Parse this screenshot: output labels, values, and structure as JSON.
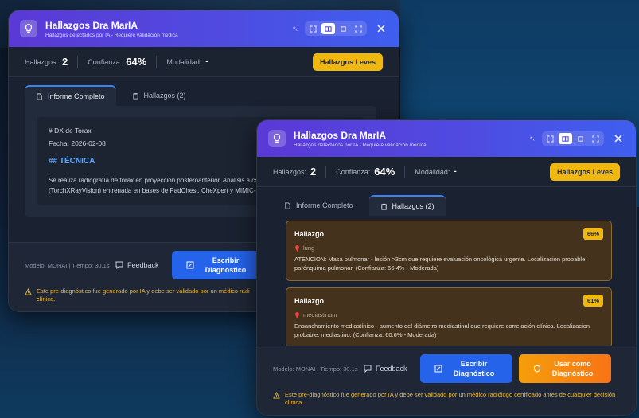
{
  "colors": {
    "accent": "#4f4be0",
    "warning": "#f0b70f",
    "primary": "#2563eb",
    "orange": "#f97316"
  },
  "window1": {
    "title": "Hallazgos Dra MarIA",
    "subtitle": "Hallazgos detectados por IA - Requiere validación médica",
    "stats": {
      "findings_label": "Hallazgos:",
      "findings_value": "2",
      "confidence_label": "Confianza:",
      "confidence_value": "64%",
      "modality_label": "Modalidad:",
      "modality_value": "-"
    },
    "severity_badge": "Hallazgos Leves",
    "tabs": [
      {
        "label": "Informe Completo",
        "icon": "document-icon"
      },
      {
        "label": "Hallazgos (2)",
        "icon": "clipboard-icon"
      }
    ],
    "report": {
      "line1": "# DX de Torax",
      "line2": "Fecha: 2026-02-08",
      "heading": "## TÉCNICA",
      "para": "Se realiza radiografía de torax en proyeccion posteroanterior. Analisis a convolucional DenseNet-121 (TorchXRayVision) entrenada en bases de PadChest, CheXpert y MIMIC-CXR."
    },
    "footer": {
      "model_info": "Modelo: MONAI | Tiempo: 30.1s",
      "feedback": "Feedback",
      "write_label": "Escribir Diagnóstico",
      "disclaimer": "Este pre-diagnóstico fue generado por IA y debe ser validado por un médico radi clínica."
    }
  },
  "window2": {
    "title": "Hallazgos Dra MarIA",
    "subtitle": "Hallazgos detectados por IA - Requiere validación médica",
    "stats": {
      "findings_label": "Hallazgos:",
      "findings_value": "2",
      "confidence_label": "Confianza:",
      "confidence_value": "64%",
      "modality_label": "Modalidad:",
      "modality_value": "-"
    },
    "severity_badge": "Hallazgos Leves",
    "tabs": [
      {
        "label": "Informe Completo",
        "icon": "document-icon"
      },
      {
        "label": "Hallazgos (2)",
        "icon": "clipboard-icon"
      }
    ],
    "findings": [
      {
        "title": "Hallazgo",
        "percent": "66%",
        "location": "lung",
        "description": "ATENCION: Masa pulmonar - lesión >3cm que requiere evaluación oncológica urgente. Localizacion probable: parénquima pulmonar. (Confianza: 66.4% - Moderada)"
      },
      {
        "title": "Hallazgo",
        "percent": "61%",
        "location": "mediastinum",
        "description": "Ensanchamiento mediastínico - aumento del diámetro mediastinal que requiere correlación clínica. Localizacion probable: mediastino. (Confianza: 60.6% - Moderada)"
      }
    ],
    "footer": {
      "model_info": "Modelo: MONAI | Tiempo: 30.1s",
      "feedback": "Feedback",
      "write_label": "Escribir Diagnóstico",
      "use_label": "Usar como Diagnóstico",
      "disclaimer": "Este pre-diagnóstico fue generado por IA y debe ser validado por un médico radiólogo certificado antes de cualquier decisión clínica."
    }
  }
}
